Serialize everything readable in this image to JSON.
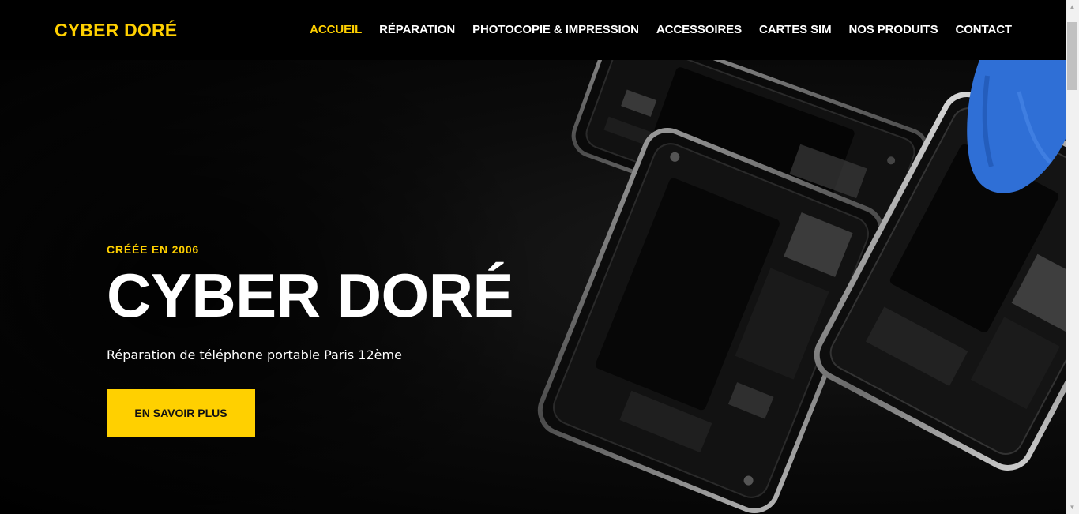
{
  "colors": {
    "accent": "#ffd000",
    "background": "#000000",
    "text": "#ffffff",
    "glove": "#2f6fd6"
  },
  "header": {
    "logo": "CYBER DORÉ",
    "nav": [
      {
        "label": "ACCUEIL",
        "active": true
      },
      {
        "label": "RÉPARATION"
      },
      {
        "label": "PHOTOCOPIE & IMPRESSION"
      },
      {
        "label": "ACCESSOIRES"
      },
      {
        "label": "CARTES SIM"
      },
      {
        "label": "NOS PRODUITS"
      },
      {
        "label": "CONTACT"
      }
    ]
  },
  "hero": {
    "eyebrow": "CRÉÉE EN 2006",
    "title": "CYBER DORÉ",
    "subtitle": "Réparation de téléphone portable Paris 12ème",
    "cta": "EN SAVOIR PLUS",
    "image": "disassembled-smartphones-photo"
  },
  "scrollbar": {
    "up_icon": "chevron-up-icon",
    "down_icon": "chevron-down-icon"
  }
}
